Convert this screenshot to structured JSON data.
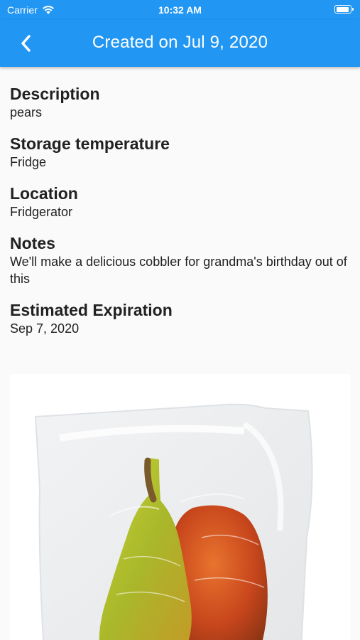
{
  "status_bar": {
    "carrier": "Carrier",
    "time": "10:32 AM",
    "battery_level": 0.95
  },
  "app_bar": {
    "title": "Created on Jul 9, 2020",
    "color": "#2196f3"
  },
  "fields": [
    {
      "label": "Description",
      "value": "pears"
    },
    {
      "label": "Storage temperature",
      "value": "Fridge"
    },
    {
      "label": "Location",
      "value": "Fridgerator"
    },
    {
      "label": "Notes",
      "value": "We'll make a delicious cobbler for grandma's birthday out of this"
    },
    {
      "label": "Estimated Expiration",
      "value": "Sep 7, 2020"
    }
  ],
  "photo": {
    "subject": "two pears in a vacuum-sealed bag"
  }
}
